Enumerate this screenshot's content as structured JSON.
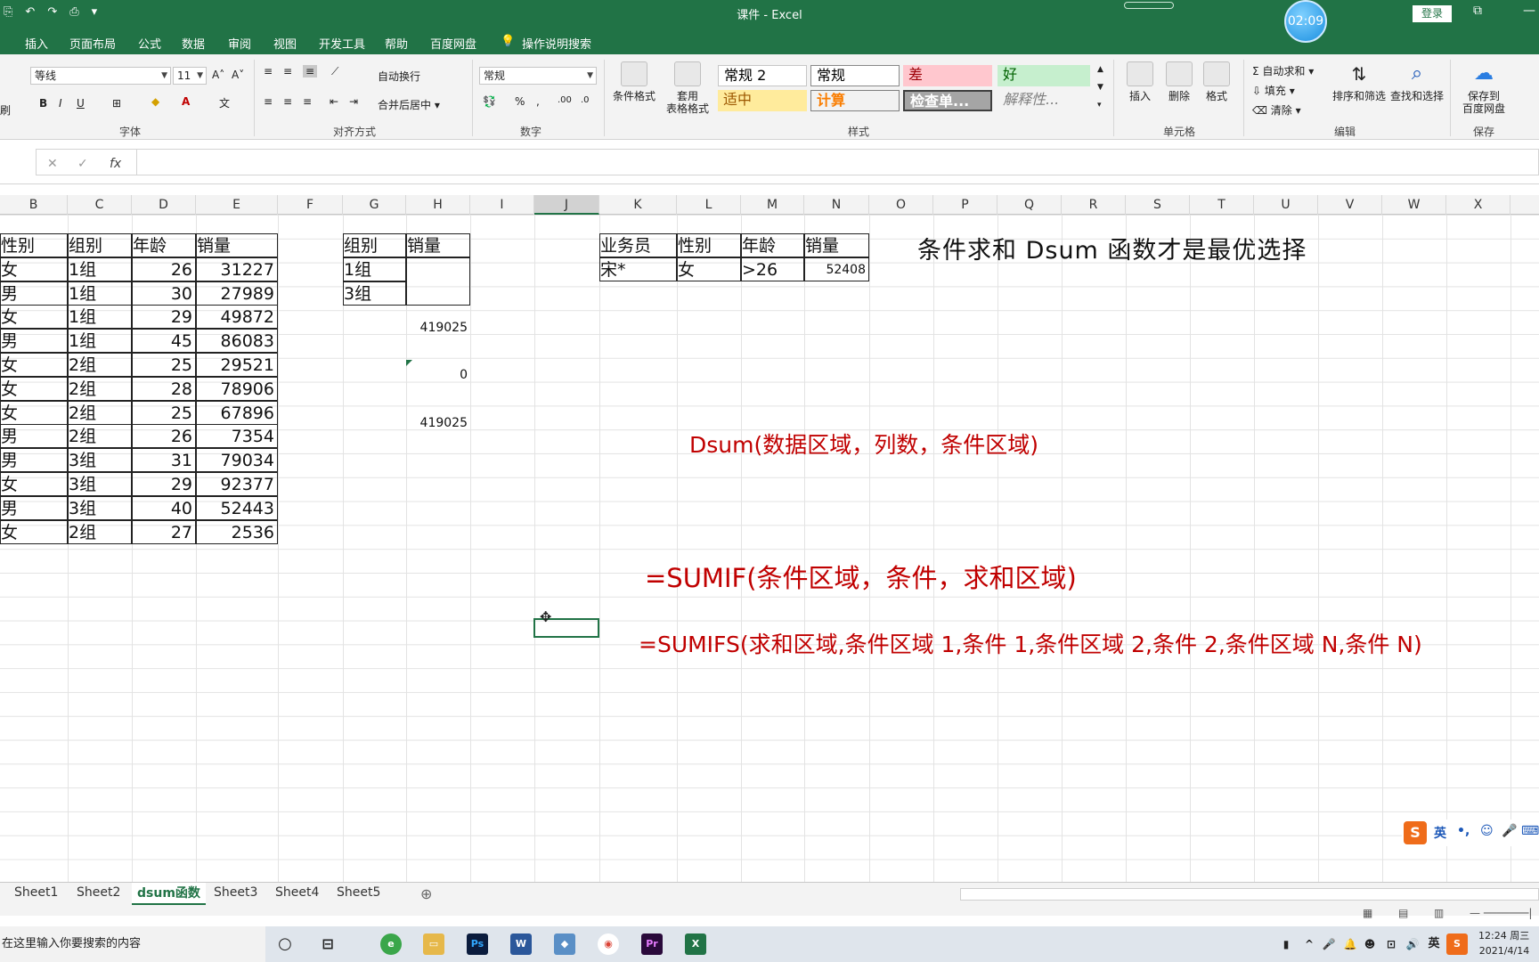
{
  "window": {
    "title": "课件 - Excel",
    "login_label": "登录",
    "timer": "02:09"
  },
  "tabs": [
    "插入",
    "页面布局",
    "公式",
    "数据",
    "审阅",
    "视图",
    "开发工具",
    "帮助",
    "百度网盘",
    "操作说明搜索"
  ],
  "ribbon": {
    "font_name": "等线",
    "font_size": "11",
    "wrap_text": "自动换行",
    "merge_center": "合并后居中",
    "number_format": "常规",
    "conditional_format": "条件格式",
    "table_format_1": "套用",
    "table_format_2": "表格格式",
    "styles": {
      "normal2": "常规 2",
      "normal": "常规",
      "bad": "差",
      "good": "好",
      "neutral": "适中",
      "calc": "计算",
      "check": "检查单...",
      "explain": "解释性..."
    },
    "insert": "插入",
    "delete": "删除",
    "format": "格式",
    "autosum": "自动求和",
    "fill": "填充",
    "clear": "清除",
    "sort_filter": "排序和筛选",
    "find_select": "查找和选择",
    "save_baidu_1": "保存到",
    "save_baidu_2": "百度网盘",
    "groups": {
      "font": "字体",
      "align": "对齐方式",
      "number": "数字",
      "styles": "样式",
      "cells": "单元格",
      "edit": "编辑",
      "save": "保存"
    },
    "partial_left": "刷"
  },
  "formula_bar": {
    "fx": "fx",
    "value": ""
  },
  "columns": [
    "B",
    "C",
    "D",
    "E",
    "F",
    "G",
    "H",
    "I",
    "J",
    "K",
    "L",
    "M",
    "N",
    "O",
    "P",
    "Q",
    "R",
    "S",
    "T",
    "U",
    "V",
    "W",
    "X"
  ],
  "selected_column": "J",
  "main_table": {
    "headers": [
      "性别",
      "组别",
      "年龄",
      "销量"
    ],
    "rows": [
      [
        "女",
        "1组",
        "26",
        "31227"
      ],
      [
        "男",
        "1组",
        "30",
        "27989"
      ],
      [
        "女",
        "1组",
        "29",
        "49872"
      ],
      [
        "男",
        "1组",
        "45",
        "86083"
      ],
      [
        "女",
        "2组",
        "25",
        "29521"
      ],
      [
        "女",
        "2组",
        "28",
        "78906"
      ],
      [
        "女",
        "2组",
        "25",
        "67896"
      ],
      [
        "男",
        "2组",
        "26",
        "7354"
      ],
      [
        "男",
        "3组",
        "31",
        "79034"
      ],
      [
        "女",
        "3组",
        "29",
        "92377"
      ],
      [
        "男",
        "3组",
        "40",
        "52443"
      ],
      [
        "女",
        "2组",
        "27",
        "2536"
      ]
    ]
  },
  "criteria_table": {
    "headers": [
      "组别",
      "销量"
    ],
    "rows": [
      [
        "1组"
      ],
      [
        "3组"
      ]
    ]
  },
  "h_values": [
    "419025",
    "0",
    "419025"
  ],
  "criteria2": {
    "headers": [
      "业务员",
      "性别",
      "年龄",
      "销量"
    ],
    "row": [
      "宋*",
      "女",
      ">26",
      "52408"
    ]
  },
  "notes": {
    "title": "条件求和 Dsum 函数才是最优选择",
    "dsum": "Dsum(数据区域，列数，条件区域)",
    "sumif": "=SUMIF(条件区域，条件，求和区域)",
    "sumifs": "=SUMIFS(求和区域,条件区域 1,条件 1,条件区域 2,条件 2,条件区域 N,条件 N)"
  },
  "sheets": [
    "Sheet1",
    "Sheet2",
    "dsum函数",
    "Sheet3",
    "Sheet4",
    "Sheet5"
  ],
  "active_sheet": "dsum函数",
  "ime_label": "英",
  "taskbar": {
    "search_text": "在这里输入你要搜索的内容",
    "time": "12:24 周三",
    "date": "2021/4/14",
    "lang": "英"
  },
  "colors": {
    "excel_green": "#217346",
    "note_red": "#c00000"
  }
}
